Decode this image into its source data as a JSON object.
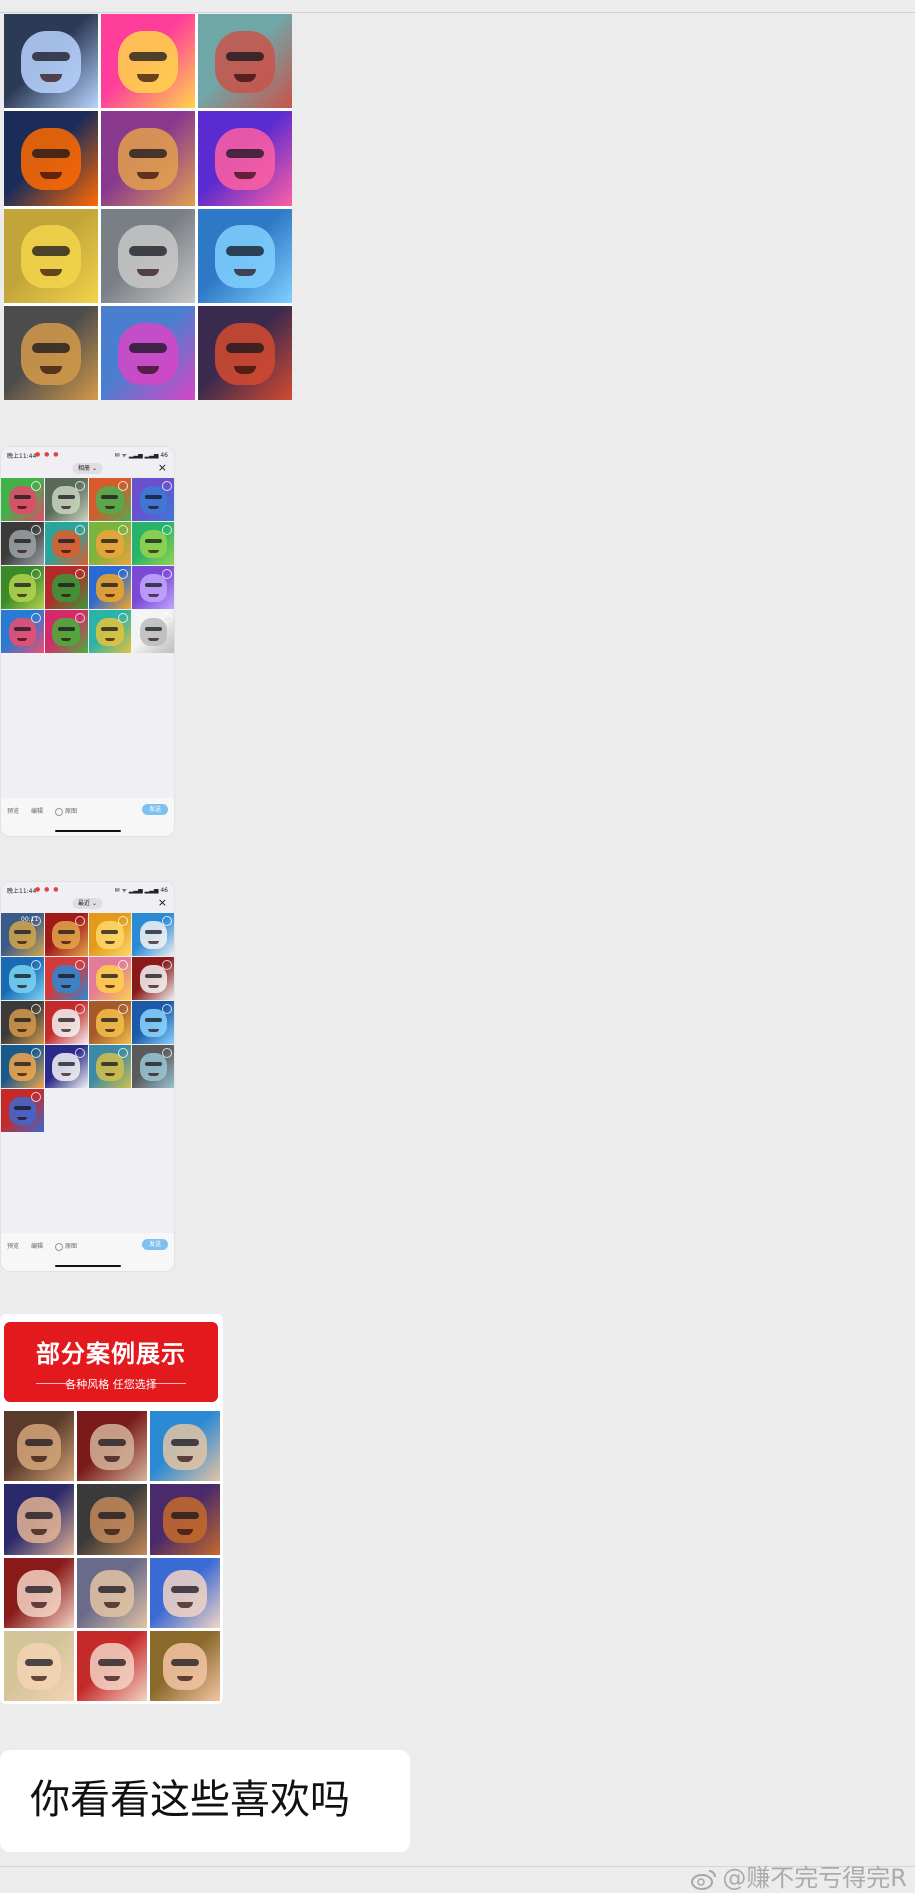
{
  "chat": {
    "image_message_1": {
      "avatar_colors": [
        [
          "#2b3a55",
          "#b8d4ff"
        ],
        [
          "#ff3d9a",
          "#ffd54a"
        ],
        [
          "#6fa7a8",
          "#c9534a"
        ],
        [
          "#1b2c5a",
          "#ff6a00"
        ],
        [
          "#8a3a8e",
          "#e3a04e"
        ],
        [
          "#5a2bd0",
          "#ff5fa2"
        ],
        [
          "#c2a53a",
          "#f3d34a"
        ],
        [
          "#7a7f86",
          "#c8c8c8"
        ],
        [
          "#2e78c6",
          "#80d0ff"
        ],
        [
          "#4c4c4c",
          "#d49a4a"
        ],
        [
          "#4a7fd0",
          "#d845c6"
        ],
        [
          "#3a2a4e",
          "#d44a30"
        ]
      ]
    },
    "phone_screenshot_1": {
      "status_time": "晚上11:44",
      "status_right": "✉ ᯤ ▂▃▅ ▂▃▅ 46",
      "album_label": "相册 ⌄",
      "close_icon": "×",
      "bottom": {
        "preview": "预览",
        "edit": "编辑",
        "original": "原图",
        "send": "发送"
      },
      "tile_colors": [
        [
          "#3fb24a",
          "#e8476b"
        ],
        [
          "#5a6a5a",
          "#c8d3bd"
        ],
        [
          "#d65a2a",
          "#4caf50"
        ],
        [
          "#6a4fcf",
          "#3a7bd5"
        ],
        [
          "#3a3a3a",
          "#9ea3a8"
        ],
        [
          "#2aa59c",
          "#e25a2a"
        ],
        [
          "#7ab33d",
          "#f1a33a"
        ],
        [
          "#29b36a",
          "#97d44d"
        ],
        [
          "#3a8a2a",
          "#b3d44d"
        ],
        [
          "#b32a2a",
          "#3a9a3a"
        ],
        [
          "#2a6ad4",
          "#f5a623"
        ],
        [
          "#7a4ad4",
          "#c3a6ff"
        ],
        [
          "#2a7ad4",
          "#f14d6a"
        ],
        [
          "#d42a6a",
          "#45b23a"
        ],
        [
          "#2ab3a6",
          "#e8c23a"
        ],
        [
          "#f4f4f4",
          "#bbbbbb"
        ]
      ]
    },
    "phone_screenshot_2": {
      "status_time": "晚上11:44",
      "status_right": "✉ ᯤ ▂▃▅ ▂▃▅ 46",
      "album_label": "最近 ⌄",
      "close_icon": "×",
      "video_duration": "00:11",
      "bottom": {
        "preview": "预览",
        "edit": "编辑",
        "original": "原图",
        "send": "发送"
      },
      "tile_colors": [
        [
          "#3a5a8a",
          "#d4a64a"
        ],
        [
          "#a11a1a",
          "#e3a64a"
        ],
        [
          "#e39a1a",
          "#ffd86a"
        ],
        [
          "#2a8ad4",
          "#f3f3f3"
        ],
        [
          "#1a6ab3",
          "#7ad4f3"
        ],
        [
          "#d43a3a",
          "#2a8ad4"
        ],
        [
          "#e37a9a",
          "#ffd04a"
        ],
        [
          "#8a1a1a",
          "#f3f3f3"
        ],
        [
          "#3a3a3a",
          "#d49a4a"
        ],
        [
          "#c42a2a",
          "#f3f3f3"
        ],
        [
          "#a65a2a",
          "#f3c04a"
        ],
        [
          "#1a5aa6",
          "#8ad4ff"
        ],
        [
          "#1a5a8a",
          "#f3a64a"
        ],
        [
          "#2a2a8a",
          "#f3f3f3"
        ],
        [
          "#3a8aa6",
          "#d4c04a"
        ],
        [
          "#5a5a5a",
          "#9ac4d4"
        ],
        [
          "#c42a2a",
          "#3a6ad4"
        ]
      ]
    },
    "image_message_2": {
      "banner_title": "部分案例展示",
      "banner_subtitle": "各种风格  任您选择",
      "portrait_colors": [
        [
          "#5a3a2a",
          "#d4a67a"
        ],
        [
          "#7a1a1a",
          "#d4b49a"
        ],
        [
          "#2a8ad4",
          "#e3c4a4"
        ],
        [
          "#2a2a6a",
          "#e3b494"
        ],
        [
          "#3a3a3a",
          "#c48a5a"
        ],
        [
          "#4a2a6a",
          "#c46a2a"
        ],
        [
          "#8a1a1a",
          "#f3d4c4"
        ],
        [
          "#6a6a8a",
          "#e3c4a4"
        ],
        [
          "#3a6ad4",
          "#f3d4c4"
        ],
        [
          "#d4c49a",
          "#f3d4b4"
        ],
        [
          "#c42a2a",
          "#f3d4c4"
        ],
        [
          "#8a6a2a",
          "#f3c4a4"
        ]
      ]
    },
    "text_message": "你看看这些喜欢吗"
  },
  "watermark": "@赚不完亏得完R"
}
